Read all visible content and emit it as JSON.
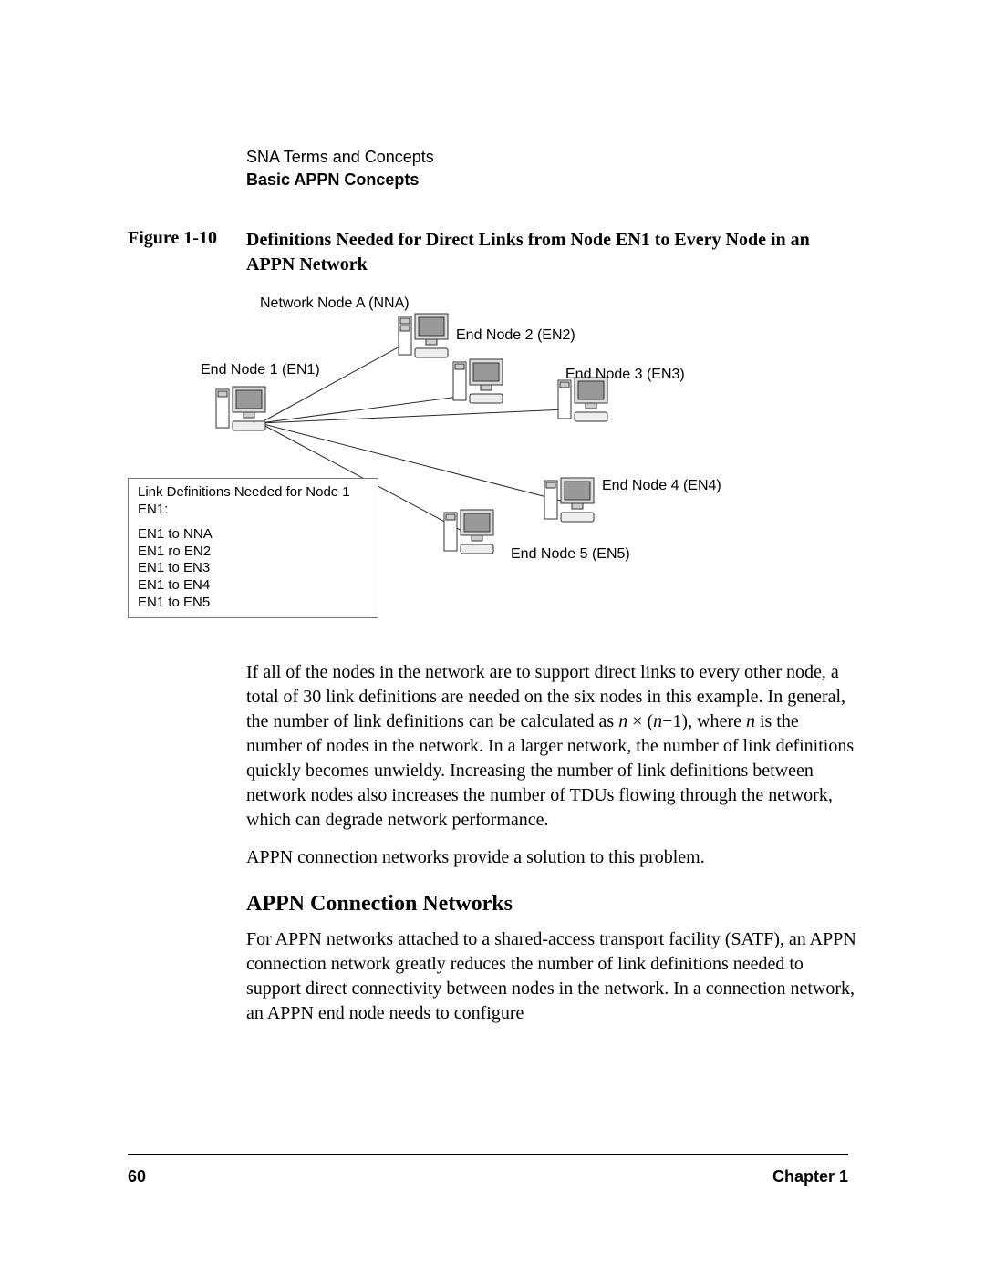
{
  "header": {
    "chapter_topic": "SNA Terms and Concepts",
    "section": "Basic APPN Concepts"
  },
  "figure": {
    "label": "Figure 1-10",
    "caption": "Definitions Needed for Direct Links from Node EN1 to Every Node in an APPN Network",
    "nodes": {
      "nna": "Network Node A (NNA)",
      "en1": "End Node 1 (EN1)",
      "en2": "End Node 2 (EN2)",
      "en3": "End Node 3 (EN3)",
      "en4": "End Node 4 (EN4)",
      "en5": "End Node 5 (EN5)"
    },
    "link_box": {
      "title": "Link Definitions Needed for Node 1 EN1:",
      "lines": [
        "EN1 to NNA",
        "EN1 ro EN2",
        "EN1 to EN3",
        "EN1 to EN4",
        "EN1 to EN5"
      ]
    }
  },
  "body": {
    "p1_a": "If all of the nodes in the network are to support direct links to every other node, a total of 30 link definitions are needed on the six nodes in this example. In general, the number of link definitions can be calculated as ",
    "p1_n1": "n",
    "p1_mid": " × (",
    "p1_n2": "n",
    "p1_mid2": "−1), where ",
    "p1_n3": "n",
    "p1_b": " is the number of nodes in the network. In a larger network, the number of link definitions quickly becomes unwieldy. Increasing the number of link definitions between network nodes also increases the number of TDUs flowing through the network, which can degrade network performance.",
    "p2": "APPN connection networks provide a solution to this problem.",
    "heading": "APPN Connection Networks",
    "p3": "For APPN networks attached to a shared-access transport facility (SATF), an APPN connection network greatly reduces the number of link definitions needed to support direct connectivity between nodes in the network. In a connection network, an APPN end node needs to configure"
  },
  "footer": {
    "page": "60",
    "chapter": "Chapter 1"
  }
}
